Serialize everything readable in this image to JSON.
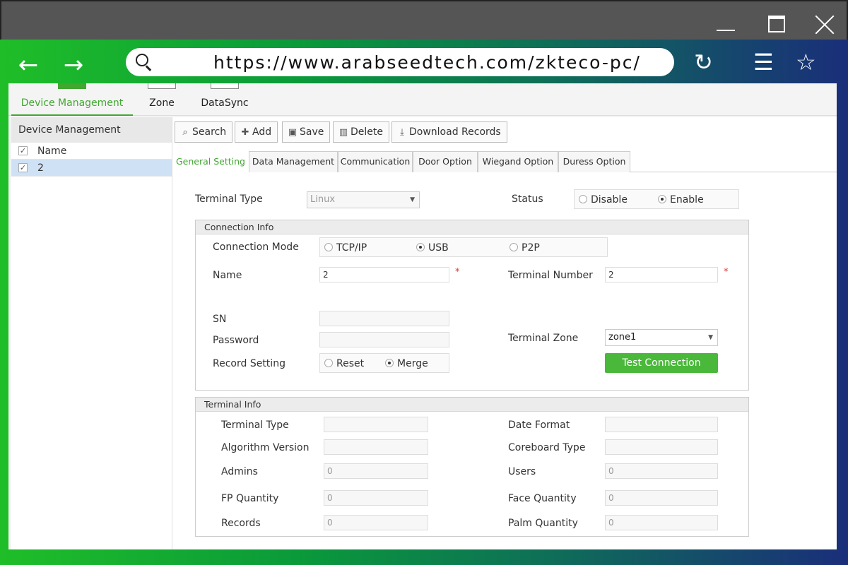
{
  "browser": {
    "url": "https://www.arabseedtech.com/zkteco-pc/",
    "back_glyph": "←",
    "forward_glyph": "→",
    "refresh_glyph": "↻",
    "menu_glyph": "☰",
    "bookmark_glyph": "☆"
  },
  "modules": [
    {
      "label": "Device Management"
    },
    {
      "label": "Zone"
    },
    {
      "label": "DataSync"
    }
  ],
  "left_panel": {
    "title": "Device Management",
    "header": "Name",
    "rows": [
      "2"
    ]
  },
  "toolbar": {
    "search": "Search",
    "add": "Add",
    "save": "Save",
    "delete": "Delete",
    "download": "Download Records"
  },
  "tabs": [
    "General Setting",
    "Data Management",
    "Communication",
    "Door Option",
    "Wiegand Option",
    "Duress Option"
  ],
  "general": {
    "terminal_type_label": "Terminal Type",
    "terminal_type_value": "Linux",
    "status_label": "Status",
    "status_disable": "Disable",
    "status_enable": "Enable"
  },
  "connection": {
    "title": "Connection Info",
    "mode_label": "Connection Mode",
    "mode_tcpip": "TCP/IP",
    "mode_usb": "USB",
    "mode_p2p": "P2P",
    "name_label": "Name",
    "name_value": "2",
    "terminal_number_label": "Terminal Number",
    "terminal_number_value": "2",
    "sn_label": "SN",
    "password_label": "Password",
    "terminal_zone_label": "Terminal Zone",
    "terminal_zone_value": "zone1",
    "record_setting_label": "Record Setting",
    "record_reset": "Reset",
    "record_merge": "Merge",
    "test_connection": "Test Connection",
    "required_mark": "*"
  },
  "terminal_info": {
    "title": "Terminal Info",
    "terminal_type": "Terminal Type",
    "date_format": "Date Format",
    "algorithm_version": "Algorithm Version",
    "coreboard_type": "Coreboard Type",
    "admins": "Admins",
    "admins_value": "0",
    "users": "Users",
    "users_value": "0",
    "fp_quantity": "FP Quantity",
    "fp_quantity_value": "0",
    "face_quantity": "Face Quantity",
    "face_quantity_value": "0",
    "records": "Records",
    "records_value": "0",
    "palm_quantity": "Palm Quantity",
    "palm_quantity_value": "0"
  },
  "colors": {
    "accent": "#41a731",
    "button_green": "#4ab83a"
  }
}
